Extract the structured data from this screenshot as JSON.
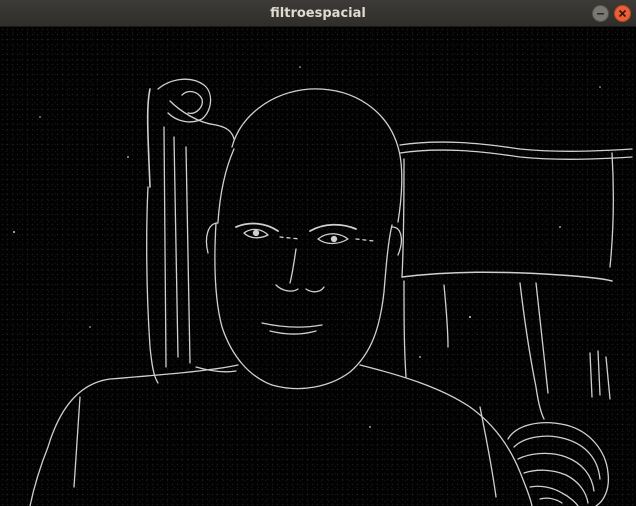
{
  "window": {
    "title": "filtroespacial"
  },
  "controls": {
    "minimize_icon": "minimize-icon",
    "close_icon": "close-icon"
  },
  "colors": {
    "titlebar": "#3c3b37",
    "close_button": "#e8603a",
    "minimize_button": "#7a7872",
    "edges": "#e8e8e8"
  }
}
